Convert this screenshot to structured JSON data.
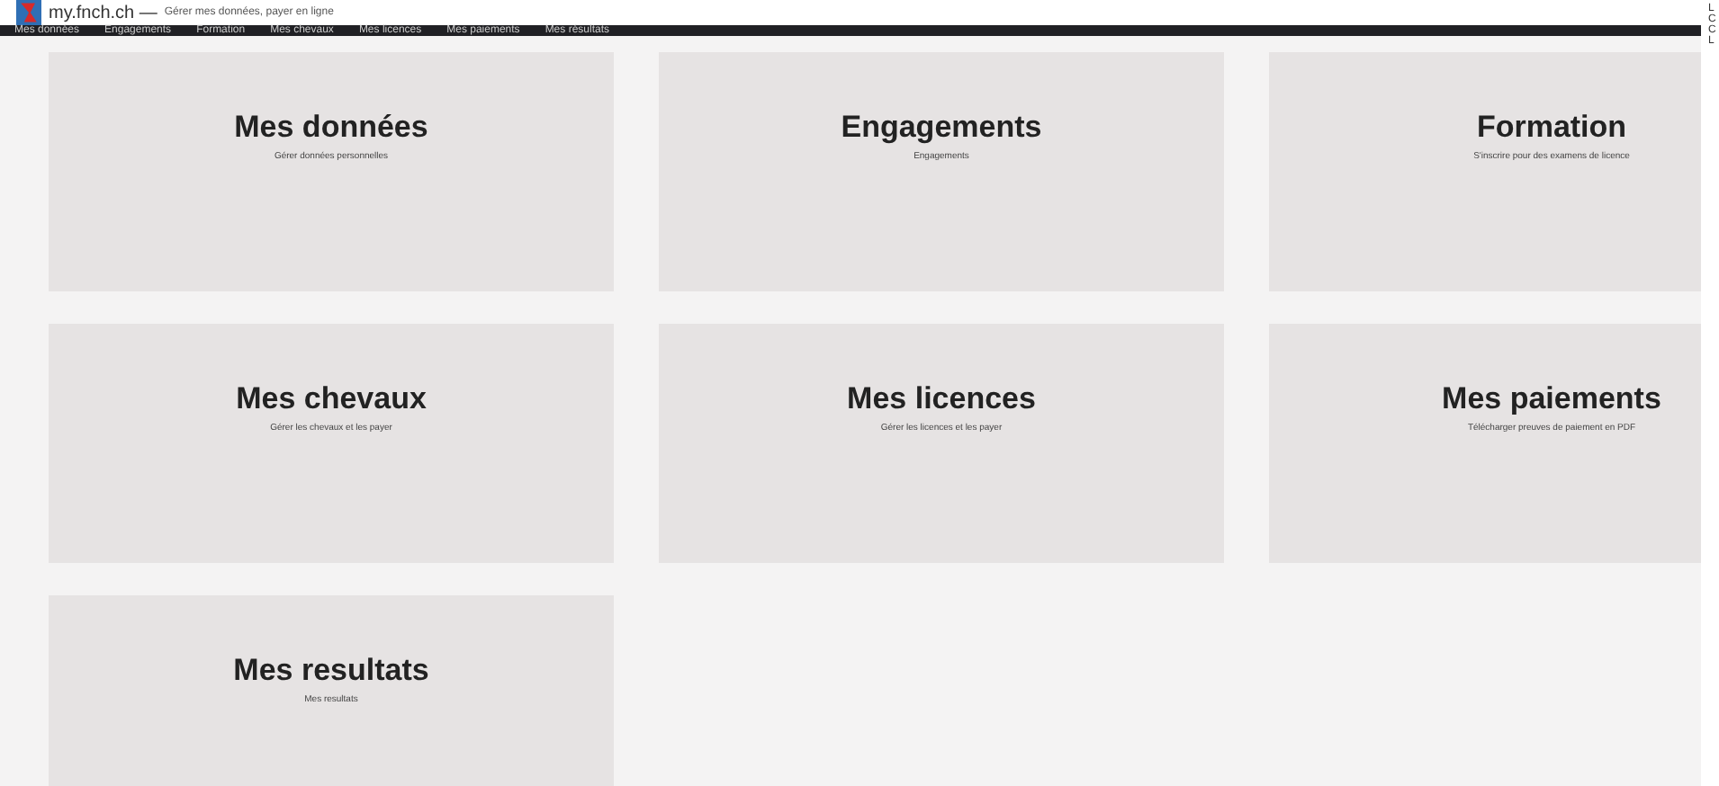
{
  "header": {
    "site": "my.fnch.ch —",
    "tagline": "Gérer mes données, payer en ligne"
  },
  "nav": [
    {
      "label": "Mes données"
    },
    {
      "label": "Engagements"
    },
    {
      "label": "Formation"
    },
    {
      "label": "Mes chevaux"
    },
    {
      "label": "Mes licences"
    },
    {
      "label": "Mes paiements"
    },
    {
      "label": "Mes résultats"
    }
  ],
  "tiles": [
    {
      "title": "Mes données",
      "subtitle": "Gérer données personnelles"
    },
    {
      "title": "Engagements",
      "subtitle": "Engagements"
    },
    {
      "title": "Formation",
      "subtitle": "S'inscrire pour des examens de licence"
    },
    {
      "title": "Mes chevaux",
      "subtitle": "Gérer les chevaux et les payer"
    },
    {
      "title": "Mes licences",
      "subtitle": "Gérer les licences et les payer"
    },
    {
      "title": "Mes paiements",
      "subtitle": "Télécharger preuves de paiement en PDF"
    },
    {
      "title": "Mes resultats",
      "subtitle": "Mes resultats"
    }
  ],
  "edge_letters": [
    "L",
    "C",
    "C",
    "L"
  ]
}
